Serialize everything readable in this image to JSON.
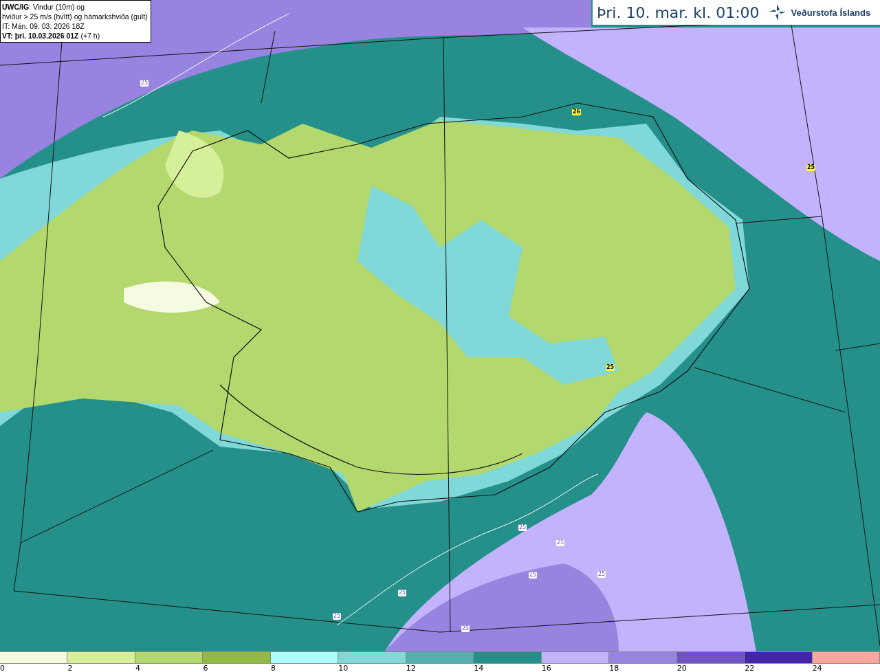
{
  "info_box": {
    "product": "UWC/IG",
    "product_desc": ": Vindur (10m) og",
    "line_2": "hviður > 25 m/s (hvítt) og hámarkshviða (gult)",
    "initial_time": "IT: Mán. 09. 03. 2026 18Z",
    "valid_label": "VT: þri. 10.03.2026 01Z",
    "valid_offset": "(+7 h)"
  },
  "header": {
    "title": "Þri. 10. mar. kl. 01:00",
    "logo_text": "Veðurstofa Íslands"
  },
  "map_labels": [
    {
      "text": "25",
      "kind": "gust"
    },
    {
      "text": "26",
      "kind": "max"
    },
    {
      "text": "25",
      "kind": "max"
    },
    {
      "text": "25",
      "kind": "max"
    },
    {
      "text": "25",
      "kind": "gust"
    },
    {
      "text": "25",
      "kind": "gust"
    },
    {
      "text": "25",
      "kind": "gust"
    },
    {
      "text": "25",
      "kind": "gust"
    },
    {
      "text": "25",
      "kind": "gust"
    },
    {
      "text": "25",
      "kind": "gust"
    },
    {
      "text": "25",
      "kind": "gust"
    }
  ],
  "legend": {
    "bins": [
      {
        "color": "#f4fbe0",
        "label": "0"
      },
      {
        "color": "#d6f09a",
        "label": "2"
      },
      {
        "color": "#b3d86d",
        "label": "4"
      },
      {
        "color": "#92ba42",
        "label": "6"
      },
      {
        "color": "#aefcfc",
        "label": "8"
      },
      {
        "color": "#80d8d8",
        "label": "10"
      },
      {
        "color": "#52b0ae",
        "label": "12"
      },
      {
        "color": "#25908a",
        "label": "14"
      },
      {
        "color": "#c2b3fc",
        "label": "16"
      },
      {
        "color": "#9883e0",
        "label": "18"
      },
      {
        "color": "#7052c4",
        "label": "20"
      },
      {
        "color": "#4326a6",
        "label": "22"
      },
      {
        "color": "#fca6a0",
        "label": "24"
      }
    ]
  }
}
